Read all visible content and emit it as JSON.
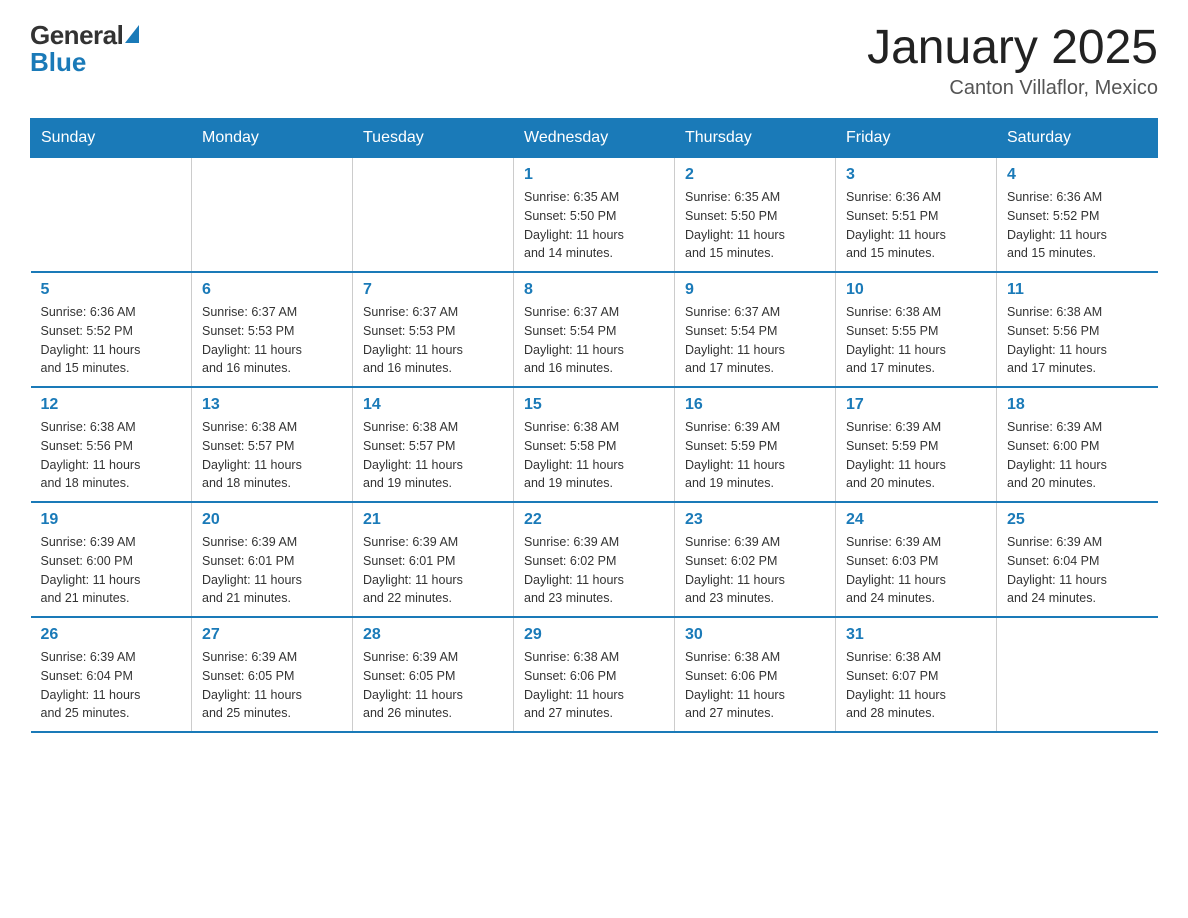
{
  "logo": {
    "general": "General",
    "blue": "Blue"
  },
  "header": {
    "month_year": "January 2025",
    "location": "Canton Villaflor, Mexico"
  },
  "days_of_week": [
    "Sunday",
    "Monday",
    "Tuesday",
    "Wednesday",
    "Thursday",
    "Friday",
    "Saturday"
  ],
  "weeks": [
    [
      {
        "day": "",
        "info": ""
      },
      {
        "day": "",
        "info": ""
      },
      {
        "day": "",
        "info": ""
      },
      {
        "day": "1",
        "info": "Sunrise: 6:35 AM\nSunset: 5:50 PM\nDaylight: 11 hours\nand 14 minutes."
      },
      {
        "day": "2",
        "info": "Sunrise: 6:35 AM\nSunset: 5:50 PM\nDaylight: 11 hours\nand 15 minutes."
      },
      {
        "day": "3",
        "info": "Sunrise: 6:36 AM\nSunset: 5:51 PM\nDaylight: 11 hours\nand 15 minutes."
      },
      {
        "day": "4",
        "info": "Sunrise: 6:36 AM\nSunset: 5:52 PM\nDaylight: 11 hours\nand 15 minutes."
      }
    ],
    [
      {
        "day": "5",
        "info": "Sunrise: 6:36 AM\nSunset: 5:52 PM\nDaylight: 11 hours\nand 15 minutes."
      },
      {
        "day": "6",
        "info": "Sunrise: 6:37 AM\nSunset: 5:53 PM\nDaylight: 11 hours\nand 16 minutes."
      },
      {
        "day": "7",
        "info": "Sunrise: 6:37 AM\nSunset: 5:53 PM\nDaylight: 11 hours\nand 16 minutes."
      },
      {
        "day": "8",
        "info": "Sunrise: 6:37 AM\nSunset: 5:54 PM\nDaylight: 11 hours\nand 16 minutes."
      },
      {
        "day": "9",
        "info": "Sunrise: 6:37 AM\nSunset: 5:54 PM\nDaylight: 11 hours\nand 17 minutes."
      },
      {
        "day": "10",
        "info": "Sunrise: 6:38 AM\nSunset: 5:55 PM\nDaylight: 11 hours\nand 17 minutes."
      },
      {
        "day": "11",
        "info": "Sunrise: 6:38 AM\nSunset: 5:56 PM\nDaylight: 11 hours\nand 17 minutes."
      }
    ],
    [
      {
        "day": "12",
        "info": "Sunrise: 6:38 AM\nSunset: 5:56 PM\nDaylight: 11 hours\nand 18 minutes."
      },
      {
        "day": "13",
        "info": "Sunrise: 6:38 AM\nSunset: 5:57 PM\nDaylight: 11 hours\nand 18 minutes."
      },
      {
        "day": "14",
        "info": "Sunrise: 6:38 AM\nSunset: 5:57 PM\nDaylight: 11 hours\nand 19 minutes."
      },
      {
        "day": "15",
        "info": "Sunrise: 6:38 AM\nSunset: 5:58 PM\nDaylight: 11 hours\nand 19 minutes."
      },
      {
        "day": "16",
        "info": "Sunrise: 6:39 AM\nSunset: 5:59 PM\nDaylight: 11 hours\nand 19 minutes."
      },
      {
        "day": "17",
        "info": "Sunrise: 6:39 AM\nSunset: 5:59 PM\nDaylight: 11 hours\nand 20 minutes."
      },
      {
        "day": "18",
        "info": "Sunrise: 6:39 AM\nSunset: 6:00 PM\nDaylight: 11 hours\nand 20 minutes."
      }
    ],
    [
      {
        "day": "19",
        "info": "Sunrise: 6:39 AM\nSunset: 6:00 PM\nDaylight: 11 hours\nand 21 minutes."
      },
      {
        "day": "20",
        "info": "Sunrise: 6:39 AM\nSunset: 6:01 PM\nDaylight: 11 hours\nand 21 minutes."
      },
      {
        "day": "21",
        "info": "Sunrise: 6:39 AM\nSunset: 6:01 PM\nDaylight: 11 hours\nand 22 minutes."
      },
      {
        "day": "22",
        "info": "Sunrise: 6:39 AM\nSunset: 6:02 PM\nDaylight: 11 hours\nand 23 minutes."
      },
      {
        "day": "23",
        "info": "Sunrise: 6:39 AM\nSunset: 6:02 PM\nDaylight: 11 hours\nand 23 minutes."
      },
      {
        "day": "24",
        "info": "Sunrise: 6:39 AM\nSunset: 6:03 PM\nDaylight: 11 hours\nand 24 minutes."
      },
      {
        "day": "25",
        "info": "Sunrise: 6:39 AM\nSunset: 6:04 PM\nDaylight: 11 hours\nand 24 minutes."
      }
    ],
    [
      {
        "day": "26",
        "info": "Sunrise: 6:39 AM\nSunset: 6:04 PM\nDaylight: 11 hours\nand 25 minutes."
      },
      {
        "day": "27",
        "info": "Sunrise: 6:39 AM\nSunset: 6:05 PM\nDaylight: 11 hours\nand 25 minutes."
      },
      {
        "day": "28",
        "info": "Sunrise: 6:39 AM\nSunset: 6:05 PM\nDaylight: 11 hours\nand 26 minutes."
      },
      {
        "day": "29",
        "info": "Sunrise: 6:38 AM\nSunset: 6:06 PM\nDaylight: 11 hours\nand 27 minutes."
      },
      {
        "day": "30",
        "info": "Sunrise: 6:38 AM\nSunset: 6:06 PM\nDaylight: 11 hours\nand 27 minutes."
      },
      {
        "day": "31",
        "info": "Sunrise: 6:38 AM\nSunset: 6:07 PM\nDaylight: 11 hours\nand 28 minutes."
      },
      {
        "day": "",
        "info": ""
      }
    ]
  ]
}
